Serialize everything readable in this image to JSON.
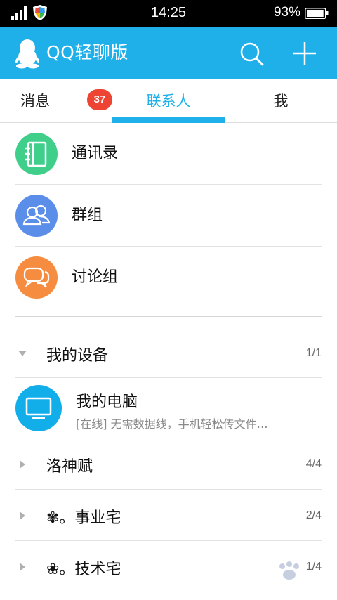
{
  "status_bar": {
    "time": "14:25",
    "battery": "93%",
    "battery_level": 0.93
  },
  "app_bar": {
    "title": "QQ轻聊版"
  },
  "tabs": [
    {
      "label": "消息",
      "badge": "37",
      "active": false
    },
    {
      "label": "联系人",
      "active": true
    },
    {
      "label": "我",
      "active": false
    }
  ],
  "quick_entries": [
    {
      "label": "通讯录",
      "icon": "address-book-icon",
      "color": "#3fcf8a"
    },
    {
      "label": "群组",
      "icon": "group-icon",
      "color": "#5b8ee8"
    },
    {
      "label": "讨论组",
      "icon": "discussion-icon",
      "color": "#f58c3f"
    }
  ],
  "groups": [
    {
      "name": "我的设备",
      "count": "1/1",
      "expanded": true
    },
    {
      "name": "洛神赋",
      "count": "4/4",
      "expanded": false
    },
    {
      "name": "✾。事业宅",
      "count": "2/4",
      "expanded": false
    },
    {
      "name": "❀。技术宅",
      "count": "1/4",
      "expanded": false
    }
  ],
  "device": {
    "title": "我的电脑",
    "subtitle": "[在线] 无需数据线，手机轻松传文件…",
    "icon": "monitor-icon"
  },
  "colors": {
    "accent": "#1fb0ea",
    "badge": "#ee4433"
  }
}
